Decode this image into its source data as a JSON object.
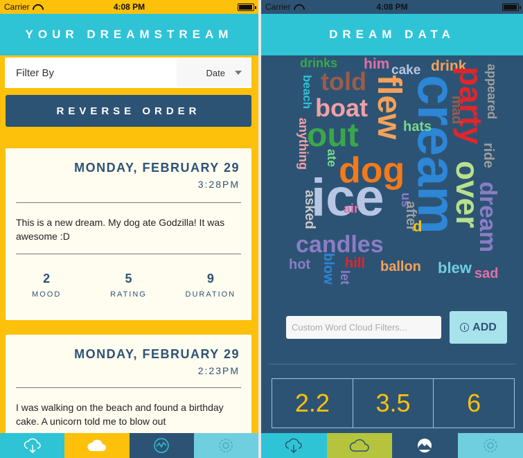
{
  "status": {
    "carrier": "Carrier",
    "time": "4:08 PM"
  },
  "left": {
    "title": "YOUR DREAMSTREAM",
    "filter": {
      "label": "Filter By",
      "value": "Date"
    },
    "reverse_button": "REVERSE ORDER",
    "cards": [
      {
        "date": "MONDAY, FEBRUARY 29",
        "time": "3:28PM",
        "text": "This is a new dream. My dog ate Godzilla! It was awesome :D",
        "stats": [
          {
            "value": "2",
            "label": "MOOD"
          },
          {
            "value": "5",
            "label": "RATING"
          },
          {
            "value": "9",
            "label": "DURATION"
          }
        ]
      },
      {
        "date": "MONDAY, FEBRUARY 29",
        "time": "2:23PM",
        "text": "I was walking on the beach and found a birthday cake. A unicorn told me to blow out"
      }
    ],
    "tabs": [
      {
        "icon": "cloud-download-icon",
        "color": "#2ec4d6"
      },
      {
        "icon": "cloud-icon",
        "color": "#fdc10b"
      },
      {
        "icon": "chart-icon",
        "color": "#2d5374"
      },
      {
        "icon": "gear-icon",
        "color": "#6fcfdf"
      }
    ]
  },
  "right": {
    "title": "DREAM DATA",
    "filter_placeholder": "Custom Word Cloud Filters...",
    "add_button": "ADD",
    "metrics": [
      "2.2",
      "3.5",
      "6"
    ],
    "tabs": [
      {
        "icon": "cloud-download-icon",
        "color": "#2ec4d6"
      },
      {
        "icon": "cloud-icon",
        "color": "#b5c43c"
      },
      {
        "icon": "wave-icon",
        "color": "#2d5374"
      },
      {
        "icon": "gear-icon",
        "color": "#6fcfdf"
      }
    ],
    "word_cloud": [
      {
        "text": "drinks",
        "color": "#3aa84a"
      },
      {
        "text": "him",
        "color": "#e26fa8"
      },
      {
        "text": "cake",
        "color": "#b7c6e4"
      },
      {
        "text": "drink",
        "color": "#f4a25a"
      },
      {
        "text": "appeared",
        "color": "#9e9e9e"
      },
      {
        "text": "told",
        "color": "#9c5c4a"
      },
      {
        "text": "flew",
        "color": "#f4a25a"
      },
      {
        "text": "cream",
        "color": "#2d86d6"
      },
      {
        "text": "party",
        "color": "#e0262c"
      },
      {
        "text": "beach",
        "color": "#2ec4d6"
      },
      {
        "text": "boat",
        "color": "#f2a0a4"
      },
      {
        "text": "mad",
        "color": "#9c5c4a"
      },
      {
        "text": "hats",
        "color": "#78d88a"
      },
      {
        "text": "out",
        "color": "#3aa84a"
      },
      {
        "text": "anything",
        "color": "#f2a0a4"
      },
      {
        "text": "ate",
        "color": "#78d88a"
      },
      {
        "text": "dog",
        "color": "#f47a1a"
      },
      {
        "text": "ride",
        "color": "#9e9e9e"
      },
      {
        "text": "over",
        "color": "#b9e08c"
      },
      {
        "text": "ice",
        "color": "#b7c6e4"
      },
      {
        "text": "air",
        "color": "#e26fa8"
      },
      {
        "text": "us",
        "color": "#8a7dc6"
      },
      {
        "text": "dream",
        "color": "#8a7dc6"
      },
      {
        "text": "asked",
        "color": "#c9c9c9"
      },
      {
        "text": "after",
        "color": "#9e9e9e"
      },
      {
        "text": "d",
        "color": "#fdc10b"
      },
      {
        "text": "candles",
        "color": "#8a7dc6"
      },
      {
        "text": "hot",
        "color": "#8a7dc6"
      },
      {
        "text": "blow",
        "color": "#2d86d6"
      },
      {
        "text": "hill",
        "color": "#e0262c"
      },
      {
        "text": "ballon",
        "color": "#f4a25a"
      },
      {
        "text": "blew",
        "color": "#6fcfdf"
      },
      {
        "text": "sad",
        "color": "#e26fa8"
      },
      {
        "text": "let",
        "color": "#8a7dc6"
      }
    ]
  }
}
